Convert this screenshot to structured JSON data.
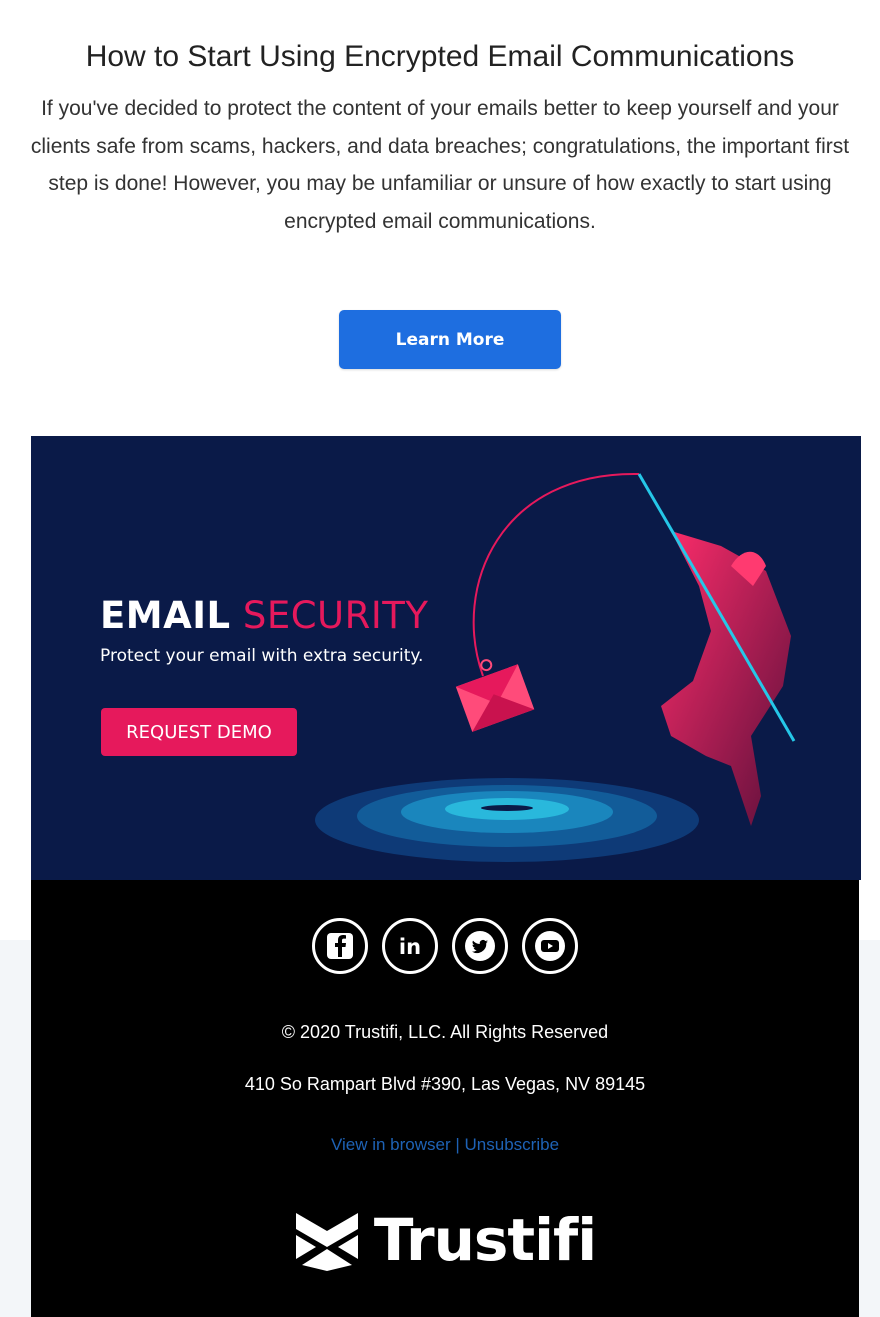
{
  "article": {
    "title": "How to Start Using Encrypted Email Communications",
    "body": "If you've decided to protect the content of your emails better to keep yourself and your clients safe from scams, hackers, and data breaches; congratulations, the important first step is done! However, you may be unfamiliar or unsure of how exactly to start using encrypted email communications.",
    "button_label": "Learn More"
  },
  "banner": {
    "title_bold": "EMAIL",
    "title_light": "SECURITY",
    "subtitle": "Protect your email with extra security.",
    "button_label": "REQUEST DEMO"
  },
  "footer": {
    "social_icons": [
      "facebook-icon",
      "linkedin-icon",
      "twitter-icon",
      "youtube-icon"
    ],
    "copyright": "© 2020 Trustifi, LLC. All Rights Reserved",
    "address": "410 So Rampart Blvd #390, Las Vegas, NV 89145",
    "view_in_browser": "View in browser",
    "separator": "|",
    "unsubscribe": "Unsubscribe",
    "brand": "Trustifi"
  },
  "colors": {
    "primary_button": "#1e6ee0",
    "banner_bg": "#0a1a48",
    "accent_pink": "#e6195c",
    "link_blue": "#1e62b5"
  }
}
